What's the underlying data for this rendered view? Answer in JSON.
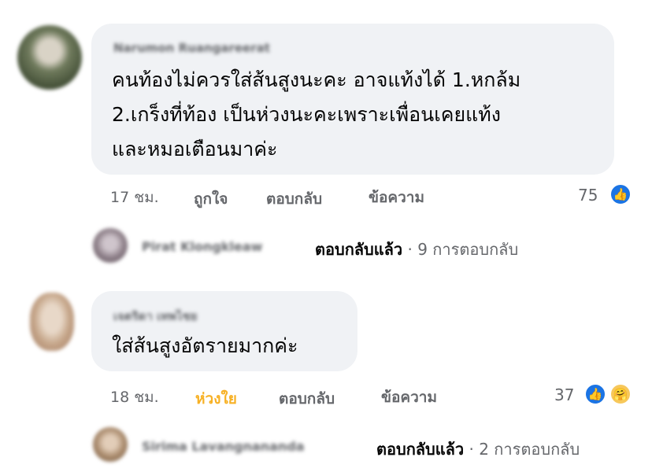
{
  "comments": [
    {
      "author": "Narumon Ruangareerat",
      "lines": [
        "คนท้องไม่ควรใส่ส้นสูงนะคะ อาจแท้งได้ 1.หกล้ม",
        "2.เกร็งที่ท้อง เป็นห่วงนะคะเพราะเพื่อนเคยแท้ง",
        "และหมอเตือนมาค่ะ"
      ],
      "time": "17 ชม.",
      "react_label": "ถูกใจ",
      "reply_label": "ตอบกลับ",
      "message_label": "ข้อความ",
      "reaction_count": "75",
      "reactions": [
        "like-icon"
      ],
      "reply_preview": {
        "author": "Pirat Klongkleaw",
        "replied_label": "ตอบกลับแล้ว",
        "reply_count": "· 9 การตอบกลับ"
      }
    },
    {
      "author": "เจตริดา เทพไชย",
      "lines": [
        "ใส่ส้นสูงอัตรายมากค่ะ"
      ],
      "time": "18 ชม.",
      "react_label": "ห่วงใย",
      "reply_label": "ตอบกลับ",
      "message_label": "ข้อความ",
      "reaction_count": "37",
      "reactions": [
        "like-icon",
        "care-icon"
      ],
      "reply_preview": {
        "author": "Sirima Lavangnananda",
        "replied_label": "ตอบกลับแล้ว",
        "reply_count": "· 2 การตอบกลับ"
      }
    }
  ],
  "colors": {
    "bubble": "#f0f2f5",
    "meta_text": "#65676b",
    "care_active": "#f7b125",
    "like_blue": "#1b74e4"
  }
}
